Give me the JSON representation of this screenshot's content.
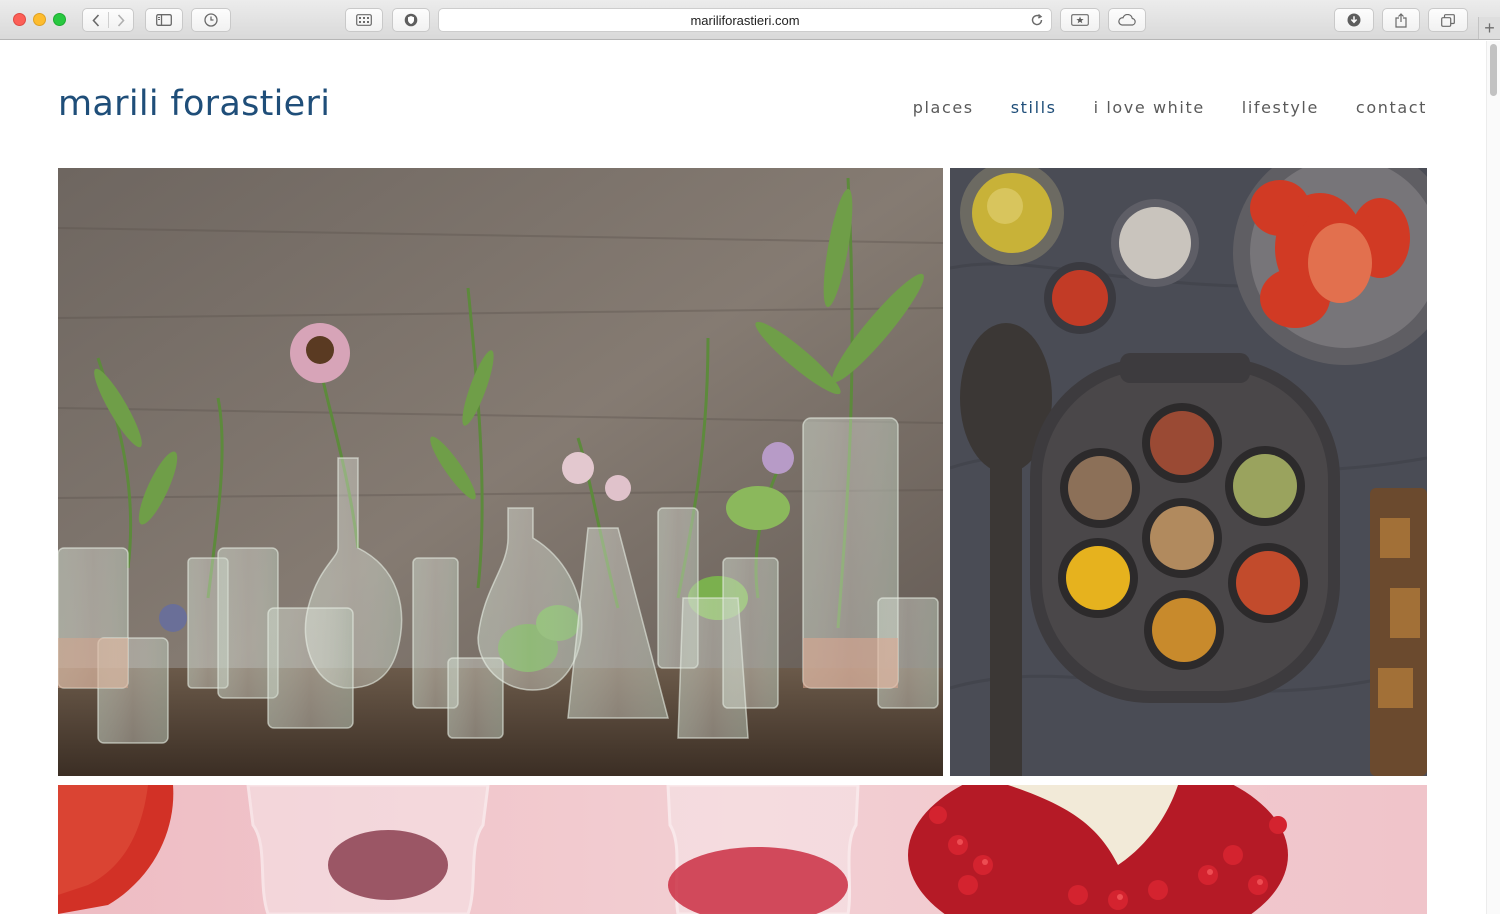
{
  "browser": {
    "url": "mariliforastieri.com",
    "icons": {
      "back": "chevron-left-icon",
      "forward": "chevron-right-icon",
      "sidebar": "sidebar-icon",
      "history": "clock-icon",
      "top_sites": "grid-icon",
      "privacy": "shield-icon",
      "reload": "reload-icon",
      "reader": "star-bookmark-icon",
      "icloud": "cloud-icon",
      "downloads": "download-icon",
      "share": "share-icon",
      "tabs": "tabs-icon",
      "new_tab": "plus-icon"
    }
  },
  "site": {
    "logo": "marili forastieri",
    "nav": [
      {
        "label": "places",
        "active": false
      },
      {
        "label": "stills",
        "active": true
      },
      {
        "label": "i love white",
        "active": false
      },
      {
        "label": "lifestyle",
        "active": false
      },
      {
        "label": "contact",
        "active": false
      }
    ],
    "colors": {
      "brand": "#1f4e79",
      "nav_text": "#5a5a5a"
    }
  },
  "gallery": {
    "photos": [
      {
        "subject": "glass-vases-with-plants-photo"
      },
      {
        "subject": "spice-tray-photo"
      },
      {
        "subject": "pomegranate-jars-photo"
      }
    ]
  }
}
